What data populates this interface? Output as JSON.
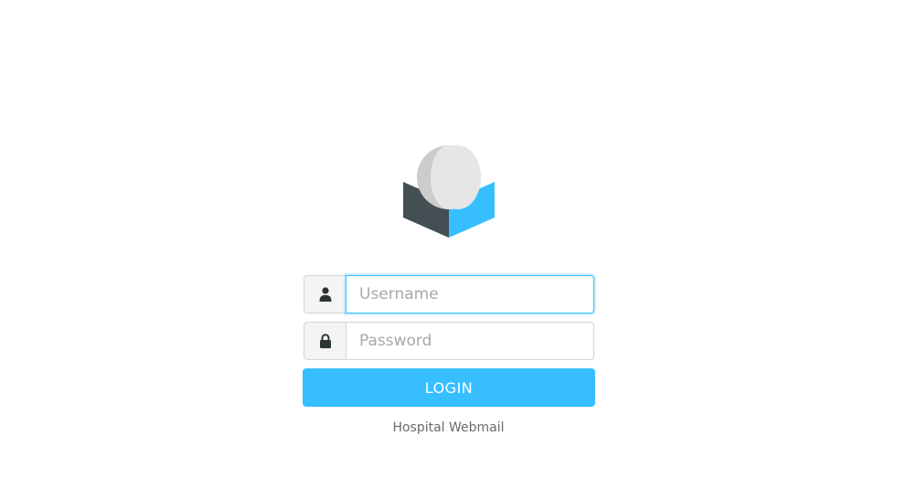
{
  "logo": {
    "icon": "roundcube-logo-icon",
    "colors": {
      "dark_face": "#444f53",
      "blue_face": "#37beff",
      "sphere_light": "#e6e6e6",
      "sphere_shadow": "#cccccc"
    }
  },
  "login_form": {
    "username": {
      "icon": "user-icon",
      "placeholder": "Username",
      "value": ""
    },
    "password": {
      "icon": "lock-icon",
      "placeholder": "Password",
      "value": ""
    },
    "login_button_label": "LOGIN"
  },
  "footer": {
    "product_name": "Hospital Webmail"
  },
  "colors": {
    "accent": "#37beff",
    "addon_bg": "#f4f4f4",
    "border": "#d5d5d5",
    "footer_text": "#6a6a6a"
  }
}
